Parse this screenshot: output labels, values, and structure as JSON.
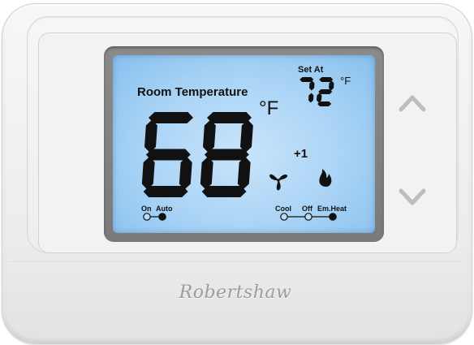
{
  "display": {
    "room_label": "Room Temperature",
    "room_temp": "68",
    "room_unit": "°F",
    "set_label": "Set At",
    "set_temp": "72",
    "set_unit": "°F",
    "offset": "+1"
  },
  "fan": {
    "options": [
      "On",
      "Auto"
    ],
    "selected": "Auto"
  },
  "system": {
    "options": [
      "Cool",
      "Off",
      "Em.Heat"
    ],
    "selected": "Em.Heat"
  },
  "brand": "Robertshaw",
  "icons": {
    "fan": "fan-icon",
    "flame": "flame-icon",
    "up": "chevron-up-icon",
    "down": "chevron-down-icon"
  },
  "colors": {
    "lcd_backlight": "#a9d3f5",
    "segment": "#111111",
    "button": "#bdbdbd"
  }
}
